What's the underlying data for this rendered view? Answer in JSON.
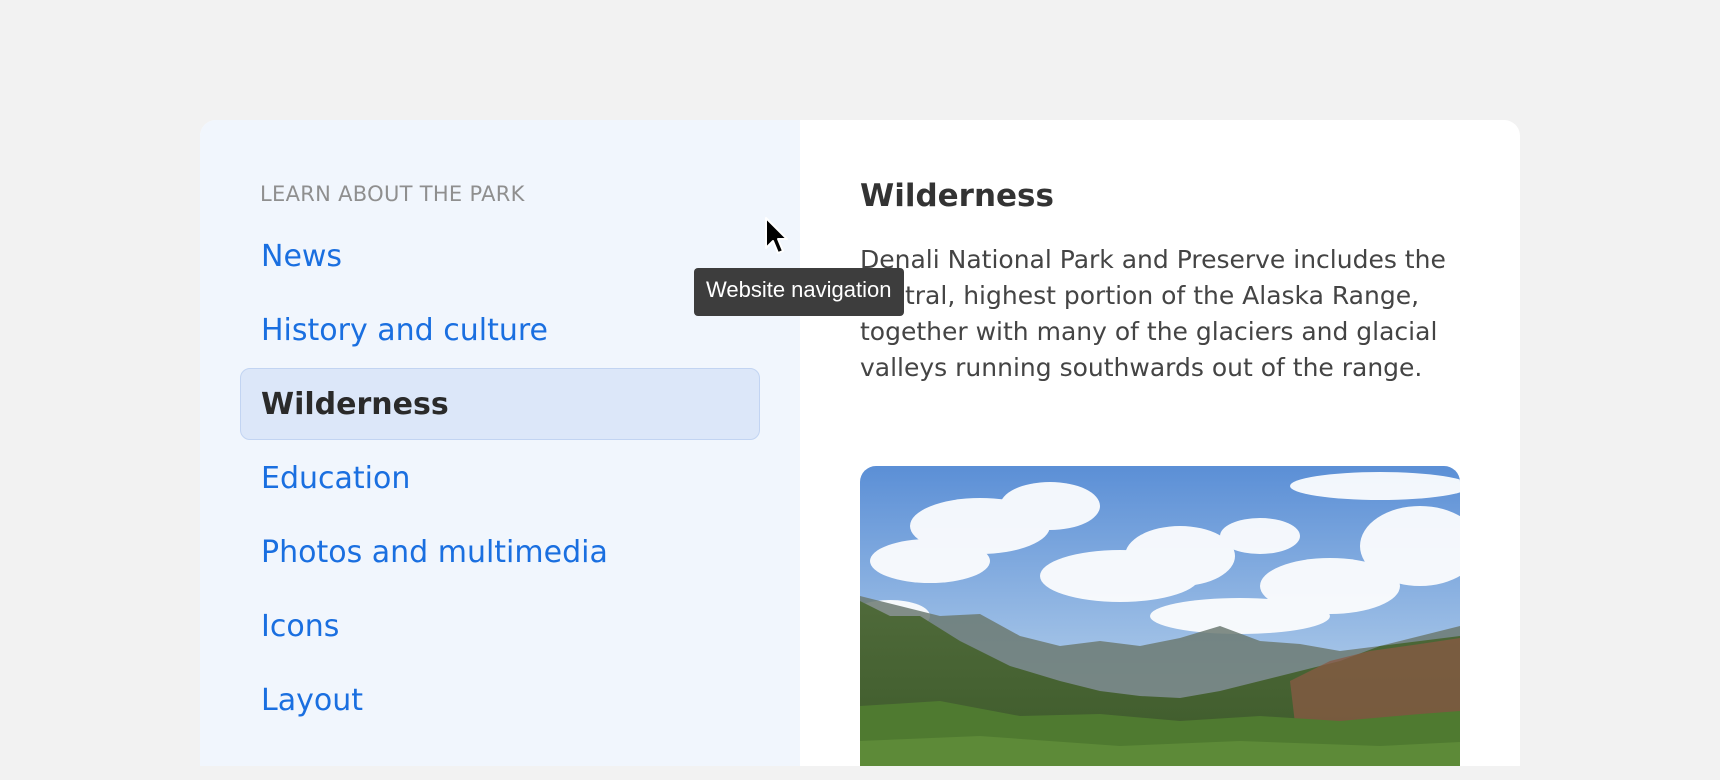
{
  "sidebar": {
    "heading": "LEARN ABOUT THE PARK",
    "items": [
      {
        "label": "News",
        "active": false
      },
      {
        "label": "History and culture",
        "active": false
      },
      {
        "label": "Wilderness",
        "active": true
      },
      {
        "label": "Education",
        "active": false
      },
      {
        "label": "Photos and multimedia",
        "active": false
      },
      {
        "label": "Icons",
        "active": false
      },
      {
        "label": "Layout",
        "active": false
      }
    ]
  },
  "main": {
    "title": "Wilderness",
    "body": "Denali National Park and Preserve includes the central, highest portion of the Alaska Range, together with many of the glaciers and glacial valleys running southwards out of the range.",
    "image_icon": "landscape-photo"
  },
  "tooltip": {
    "text": "Website navigation"
  },
  "colors": {
    "link": "#1a6fe0",
    "active_bg": "#dce7f9",
    "sidebar_bg": "#f1f6fd",
    "tooltip_bg": "#3d3d3d"
  }
}
